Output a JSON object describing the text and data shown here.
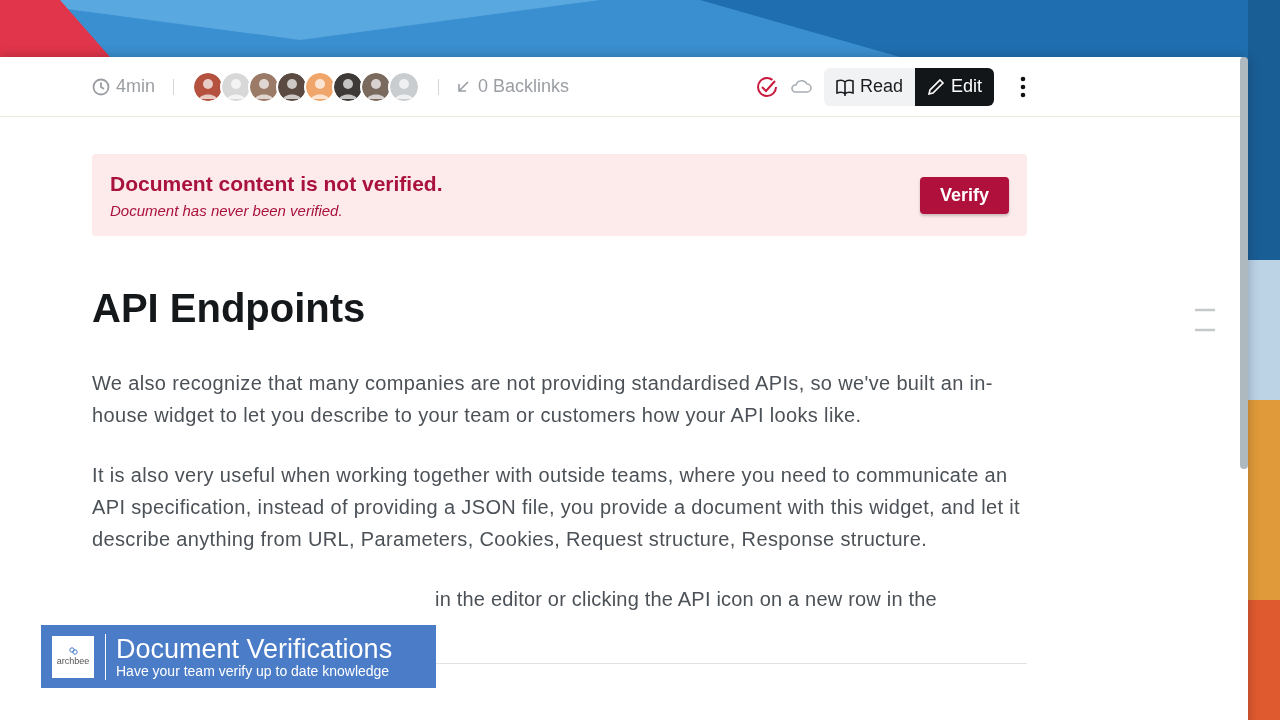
{
  "toolbar": {
    "read_time": "4min",
    "avatars": [
      {
        "color": "#b5523f"
      },
      {
        "color": "#d8d8d8"
      },
      {
        "color": "#9c7a68"
      },
      {
        "color": "#5a4a42"
      },
      {
        "color": "#f0a66a"
      },
      {
        "color": "#3e3a38"
      },
      {
        "color": "#7a6a5e"
      },
      {
        "color": "#c9cdd0"
      }
    ],
    "backlinks": "0 Backlinks",
    "modes": [
      {
        "label": "Read",
        "kind": "read",
        "selected": false
      },
      {
        "label": "Edit",
        "kind": "edit",
        "selected": true
      }
    ]
  },
  "alert": {
    "title": "Document content is not verified.",
    "subtitle": "Document has never been verified.",
    "button": "Verify"
  },
  "document": {
    "title": "API Endpoints",
    "paragraphs": [
      "We also recognize that many companies are not providing standardised APIs, so we've built an in-house widget to let you describe to your team or customers how your API looks like.",
      "It is also very useful when working together with outside teams, where you need to communicate an API specification, instead of providing a JSON file, you provide a document with this widget, and let it describe anything from URL, Parameters, Cookies, Request structure, Response structure."
    ],
    "partial_line": "in the editor or clicking the API icon on a new row in the"
  },
  "caption": {
    "brand": "archbee",
    "title": "Document Verifications",
    "subtitle": "Have your team verify up to date knowledge"
  }
}
